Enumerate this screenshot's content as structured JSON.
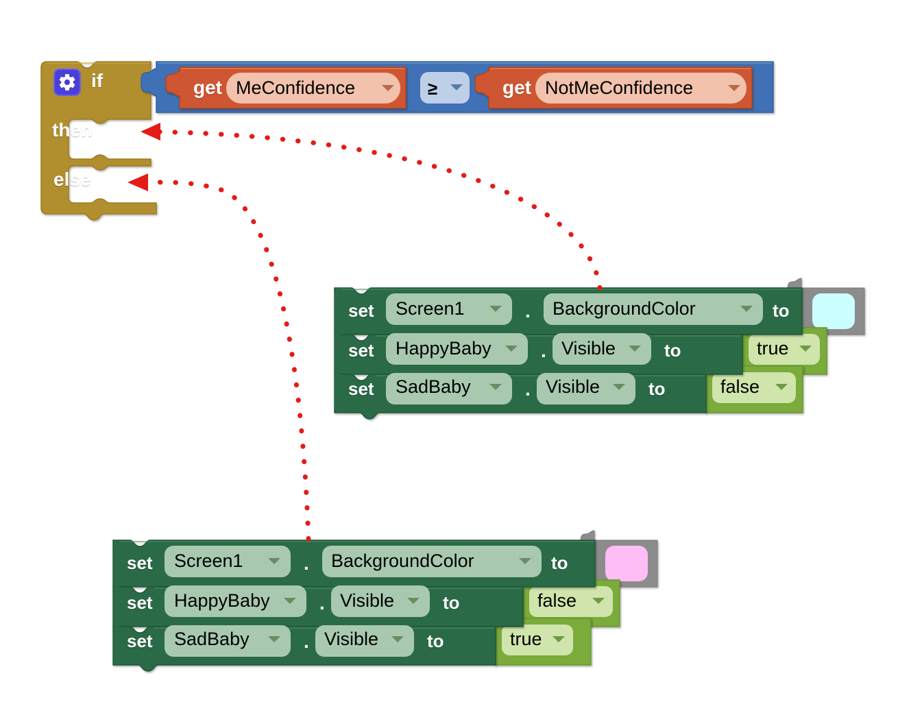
{
  "app": {
    "name": "MIT App Inventor Blocks Editor",
    "view": "blocks-canvas",
    "background": "#ffffff"
  },
  "colors": {
    "control_block": "#b18e2e",
    "logic_block": "#3f6fb5",
    "variable_block": "#cf5630",
    "variable_field": "#f2c2ac",
    "setter_block": "#2b6b47",
    "setter_field": "#a8c9b0",
    "boolean_block": "#7aab3a",
    "boolean_field": "#cfe5ac",
    "color_block": "#8c8c8c",
    "arrow_red": "#e41b17",
    "operator_field": "#bdd0e8"
  },
  "blocks": {
    "if_block": {
      "name": "if-then-else",
      "mutator_icon": "gear-icon",
      "if_label": "if",
      "then_label": "then",
      "else_label": "else"
    },
    "condition": {
      "name": "comparison",
      "operator": "≥",
      "left": {
        "prefix": "get",
        "variable": "MeConfidence"
      },
      "right": {
        "prefix": "get",
        "variable": "NotMeConfidence"
      }
    },
    "then_stack": {
      "name": "then-branch-statements",
      "rows": [
        {
          "set_label": "set",
          "component": "Screen1",
          "property": "BackgroundColor",
          "to_label": "to",
          "value_type": "color",
          "value": "#ccffff"
        },
        {
          "set_label": "set",
          "component": "HappyBaby",
          "property": "Visible",
          "to_label": "to",
          "value_type": "boolean",
          "value": "true"
        },
        {
          "set_label": "set",
          "component": "SadBaby",
          "property": "Visible",
          "to_label": "to",
          "value_type": "boolean",
          "value": "false"
        }
      ]
    },
    "else_stack": {
      "name": "else-branch-statements",
      "rows": [
        {
          "set_label": "set",
          "component": "Screen1",
          "property": "BackgroundColor",
          "to_label": "to",
          "value_type": "color",
          "value": "#ffbdf5"
        },
        {
          "set_label": "set",
          "component": "HappyBaby",
          "property": "Visible",
          "to_label": "to",
          "value_type": "boolean",
          "value": "false"
        },
        {
          "set_label": "set",
          "component": "SadBaby",
          "property": "Visible",
          "to_label": "to",
          "value_type": "boolean",
          "value": "true"
        }
      ]
    }
  },
  "annotations": [
    {
      "name": "arrow-then-to-first-stack",
      "from": "then-stack",
      "to": "then-socket",
      "style": "dotted",
      "color": "#e41b17"
    },
    {
      "name": "arrow-else-to-second-stack",
      "from": "else-stack",
      "to": "else-socket",
      "style": "dotted",
      "color": "#e41b17"
    }
  ],
  "glyphs": {
    "dot_separator": ".",
    "dropdown_caret": "▼"
  }
}
